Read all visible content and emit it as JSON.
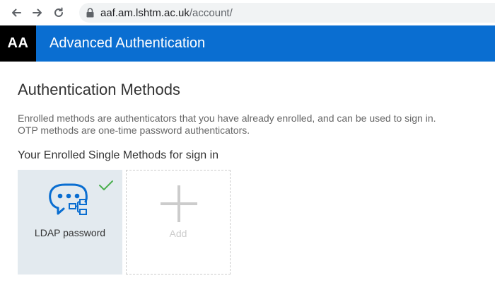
{
  "browser": {
    "url_host": "aaf.am.lshtm.ac.uk",
    "url_path": "/account/",
    "icons": [
      "back-arrow-icon",
      "forward-arrow-icon",
      "reload-icon",
      "lock-icon"
    ]
  },
  "header": {
    "logo": "AA",
    "title": "Advanced Authentication",
    "color": "#0a6ed1"
  },
  "main": {
    "title": "Authentication Methods",
    "description_line1": "Enrolled methods are authenticators that you have already enrolled, and can be used to sign in.",
    "description_line2": "OTP methods are one-time password authenticators.",
    "section_title": "Your Enrolled Single Methods for sign in",
    "methods": [
      {
        "label": "LDAP password",
        "icon": "ldap-password-icon",
        "status_icon": "check-icon",
        "enrolled": true
      }
    ],
    "add_tile": {
      "label": "Add",
      "icon": "plus-icon"
    }
  },
  "colors": {
    "accent": "#0a6ed1",
    "check": "#4caf50",
    "tile_bg": "#e3eaef"
  }
}
